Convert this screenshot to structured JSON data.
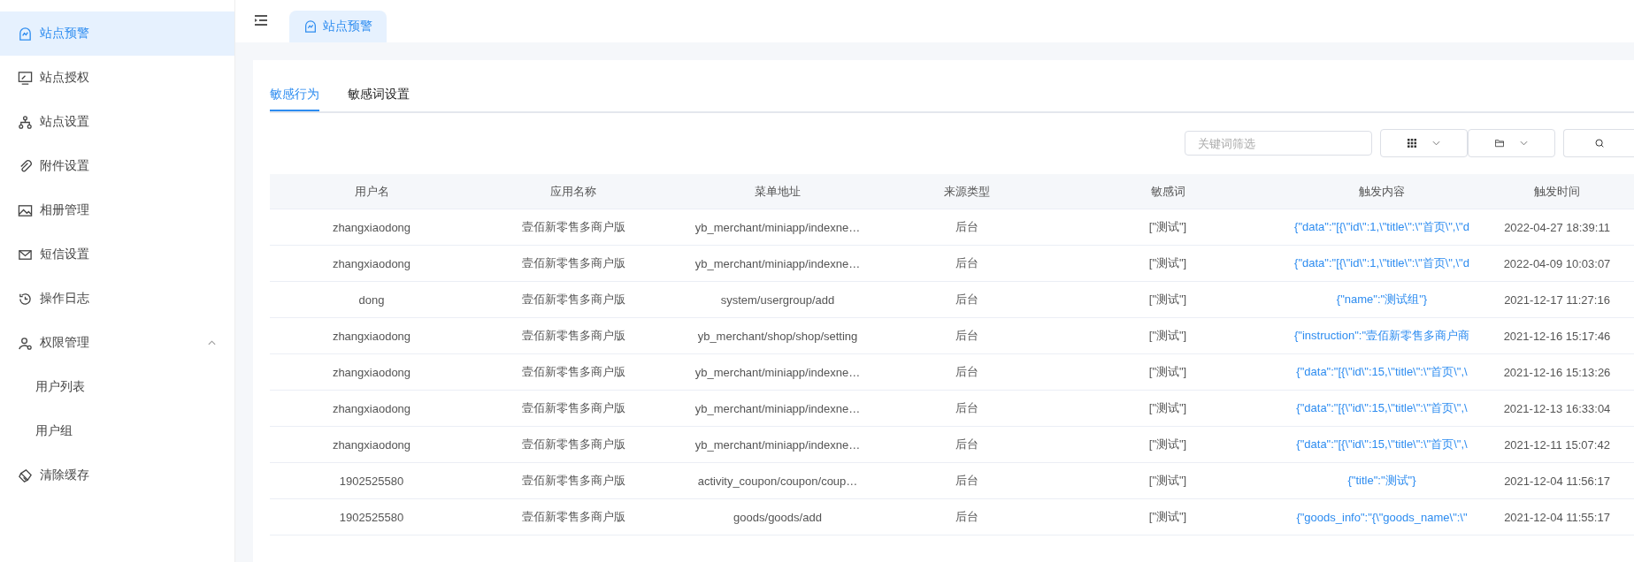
{
  "sidebar": {
    "items": [
      {
        "label": "站点预警",
        "selected": true
      },
      {
        "label": "站点授权",
        "selected": false
      },
      {
        "label": "站点设置",
        "selected": false
      },
      {
        "label": "附件设置",
        "selected": false
      },
      {
        "label": "相册管理",
        "selected": false
      },
      {
        "label": "短信设置",
        "selected": false
      },
      {
        "label": "操作日志",
        "selected": false
      },
      {
        "label": "权限管理",
        "selected": false,
        "expanded": true,
        "children": [
          {
            "label": "用户列表",
            "selected": false
          },
          {
            "label": "用户组",
            "selected": false
          }
        ]
      },
      {
        "label": "清除缓存",
        "selected": false
      }
    ]
  },
  "page_tabs": [
    {
      "label": "站点预警",
      "selected": true
    }
  ],
  "tabs": [
    {
      "label": "敏感行为",
      "selected": true
    },
    {
      "label": "敏感词设置",
      "selected": false
    }
  ],
  "search": {
    "placeholder": "关键词筛选"
  },
  "table": {
    "columns": [
      "用户名",
      "应用名称",
      "菜单地址",
      "来源类型",
      "敏感词",
      "触发内容",
      "触发时间"
    ],
    "rows": [
      [
        "zhangxiaodong",
        "壹佰新零售多商户版",
        "yb_merchant/miniapp/indexne…",
        "后台",
        "[\"测试\"]",
        "{\"data\":\"[{\\\"id\\\":1,\\\"title\\\":\\\"首页\\\",\\\"d",
        "2022-04-27 18:39:11"
      ],
      [
        "zhangxiaodong",
        "壹佰新零售多商户版",
        "yb_merchant/miniapp/indexne…",
        "后台",
        "[\"测试\"]",
        "{\"data\":\"[{\\\"id\\\":1,\\\"title\\\":\\\"首页\\\",\\\"d",
        "2022-04-09 10:03:07"
      ],
      [
        "dong",
        "壹佰新零售多商户版",
        "system/usergroup/add",
        "后台",
        "[\"测试\"]",
        "{\"name\":\"测试组\"}",
        "2021-12-17 11:27:16"
      ],
      [
        "zhangxiaodong",
        "壹佰新零售多商户版",
        "yb_merchant/shop/shop/setting",
        "后台",
        "[\"测试\"]",
        "{\"instruction\":\"壹佰新零售多商户商",
        "2021-12-16 15:17:46"
      ],
      [
        "zhangxiaodong",
        "壹佰新零售多商户版",
        "yb_merchant/miniapp/indexne…",
        "后台",
        "[\"测试\"]",
        "{\"data\":\"[{\\\"id\\\":15,\\\"title\\\":\\\"首页\\\",\\",
        "2021-12-16 15:13:26"
      ],
      [
        "zhangxiaodong",
        "壹佰新零售多商户版",
        "yb_merchant/miniapp/indexne…",
        "后台",
        "[\"测试\"]",
        "{\"data\":\"[{\\\"id\\\":15,\\\"title\\\":\\\"首页\\\",\\",
        "2021-12-13 16:33:04"
      ],
      [
        "zhangxiaodong",
        "壹佰新零售多商户版",
        "yb_merchant/miniapp/indexne…",
        "后台",
        "[\"测试\"]",
        "{\"data\":\"[{\\\"id\\\":15,\\\"title\\\":\\\"首页\\\",\\",
        "2021-12-11 15:07:42"
      ],
      [
        "1902525580",
        "壹佰新零售多商户版",
        "activity_coupon/coupon/coup…",
        "后台",
        "[\"测试\"]",
        "{\"title\":\"测试\"}",
        "2021-12-04 11:56:17"
      ],
      [
        "1902525580",
        "壹佰新零售多商户版",
        "goods/goods/add",
        "后台",
        "[\"测试\"]",
        "{\"goods_info\":\"{\\\"goods_name\\\":\\\"",
        "2021-12-04 11:55:17"
      ]
    ]
  }
}
